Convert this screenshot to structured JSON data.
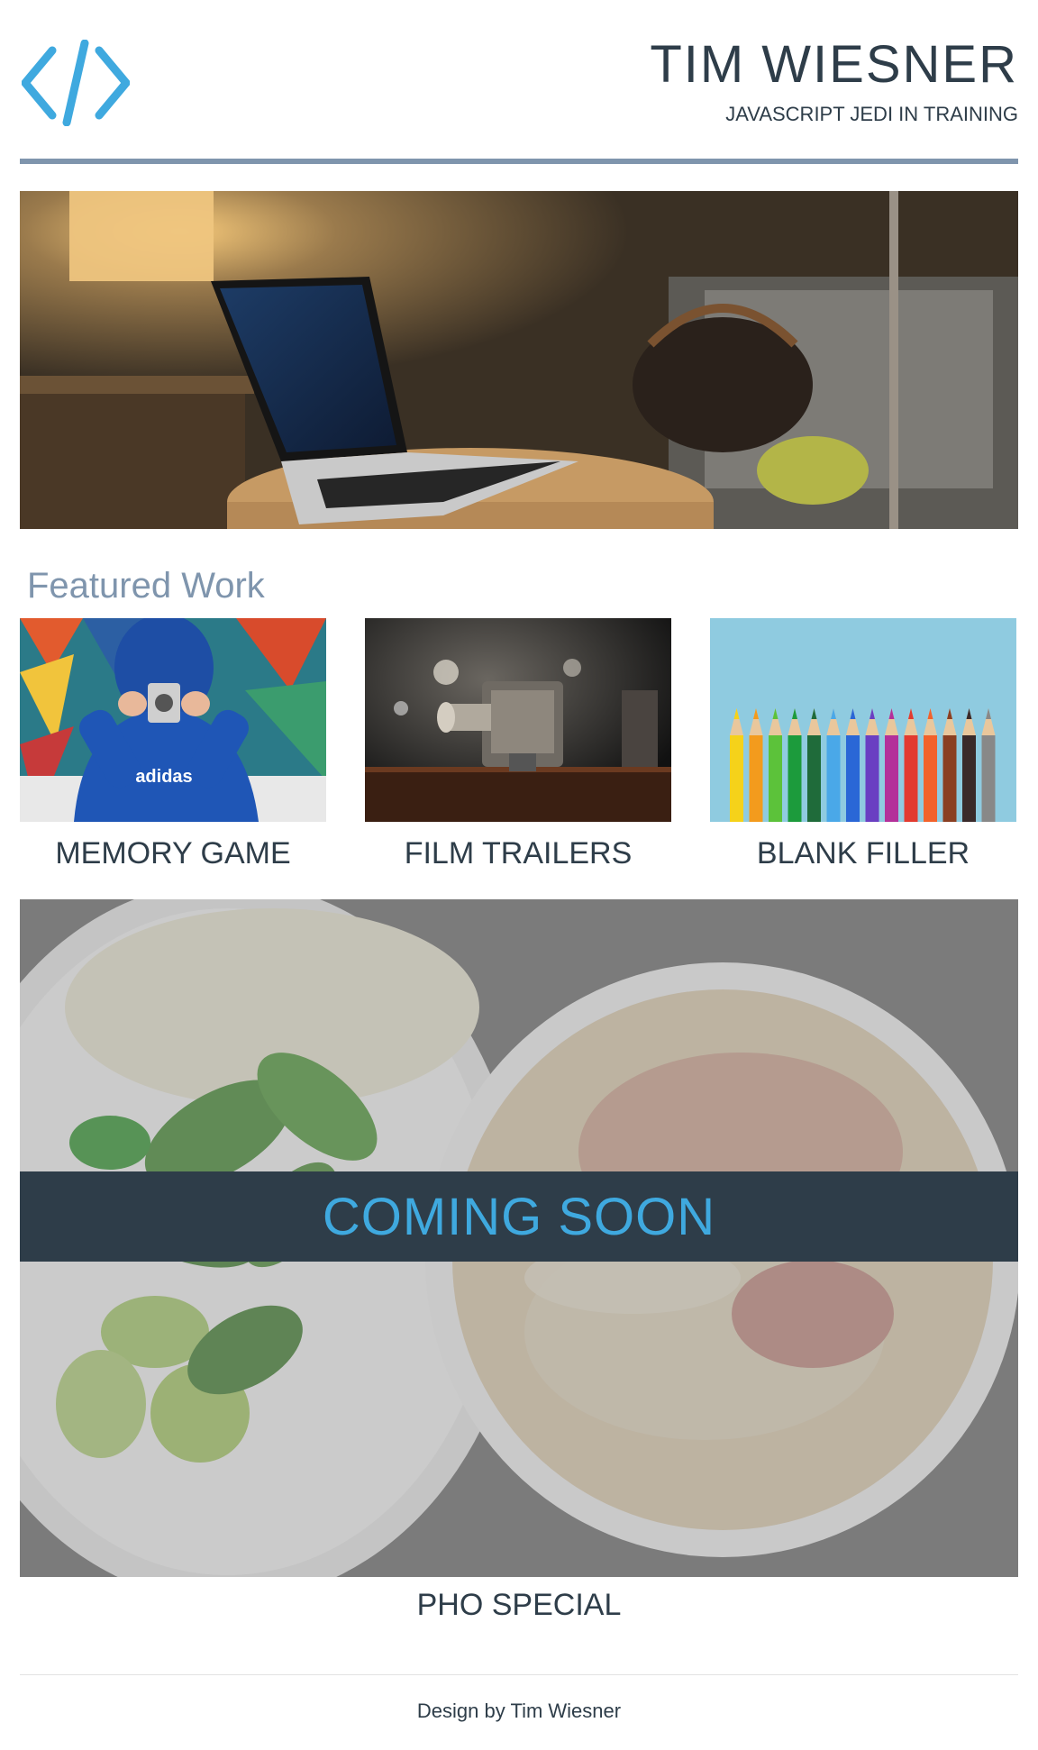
{
  "header": {
    "logo_icon": "code-brackets-icon",
    "title": "TIM WIESNER",
    "subtitle": "JAVASCRIPT JEDI IN TRAINING"
  },
  "featured": {
    "heading": "Featured Work",
    "cards": [
      {
        "label": "MEMORY GAME"
      },
      {
        "label": "FILM TRAILERS"
      },
      {
        "label": "BLANK FILLER"
      }
    ]
  },
  "pho": {
    "banner": "COMING SOON",
    "label": "PHO SPECIAL"
  },
  "footer": {
    "credit": "Design by Tim Wiesner"
  },
  "colors": {
    "accent": "#3fa9df",
    "text": "#2e3d49",
    "rule": "#7f95ad"
  }
}
